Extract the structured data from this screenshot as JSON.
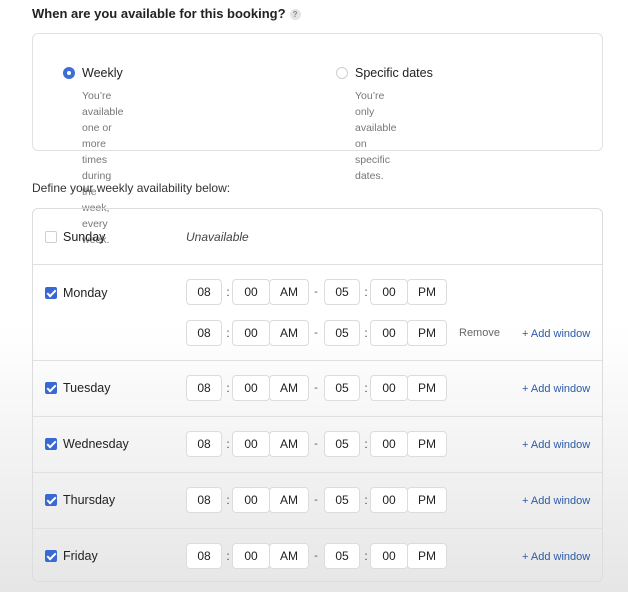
{
  "question": {
    "title": "When are you available for this booking?",
    "help_icon": "?"
  },
  "options": [
    {
      "label": "Weekly",
      "desc1": "You’re available one or more times during the",
      "desc2": "week, every week.",
      "selected": true
    },
    {
      "label": "Specific dates",
      "desc1": "You’re only available on specific dates.",
      "desc2": "",
      "selected": false
    }
  ],
  "subtitle": "Define your weekly availability below:",
  "days": [
    {
      "name": "Sunday",
      "checked": false,
      "unavailable_text": "Unavailable"
    },
    {
      "name": "Monday",
      "checked": true,
      "add_label": "+ Add window",
      "remove_label": "Remove",
      "win1": {
        "sh": "08",
        "sm": "00",
        "sap": "AM",
        "eh": "05",
        "em": "00",
        "eap": "PM"
      },
      "win2": {
        "sh": "08",
        "sm": "00",
        "sap": "AM",
        "eh": "05",
        "em": "00",
        "eap": "PM"
      }
    },
    {
      "name": "Tuesday",
      "checked": true,
      "add_label": "+ Add window",
      "win1": {
        "sh": "08",
        "sm": "00",
        "sap": "AM",
        "eh": "05",
        "em": "00",
        "eap": "PM"
      }
    },
    {
      "name": "Wednesday",
      "checked": true,
      "add_label": "+ Add window",
      "win1": {
        "sh": "08",
        "sm": "00",
        "sap": "AM",
        "eh": "05",
        "em": "00",
        "eap": "PM"
      }
    },
    {
      "name": "Thursday",
      "checked": true,
      "add_label": "+ Add window",
      "win1": {
        "sh": "08",
        "sm": "00",
        "sap": "AM",
        "eh": "05",
        "em": "00",
        "eap": "PM"
      }
    },
    {
      "name": "Friday",
      "checked": true,
      "add_label": "+ Add window",
      "win1": {
        "sh": "08",
        "sm": "00",
        "sap": "AM",
        "eh": "05",
        "em": "00",
        "eap": "PM"
      }
    }
  ],
  "colon": ":",
  "dash": "-",
  "colors": {
    "accent": "#3868d1",
    "link": "#2c5aa8",
    "border": "#dcdcdc"
  }
}
